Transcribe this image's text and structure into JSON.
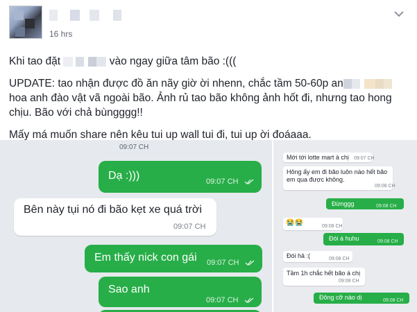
{
  "post": {
    "timestamp": "16 hrs",
    "line1_before": "Khi tao đặt",
    "line1_after": "vào ngay giữa tâm bão :(((",
    "update_text": "UPDATE: tao nhận được đồ ăn nãy giờ ời nhenn, chắc tầm 50-60p an",
    "update_rest": "hoa anh đào vật vã ngoài bão. Ảnh rủ tao bão không ảnh hốt đi, nhưng tao hong chịu. Bão với chả bùngggg!!",
    "share_text": "Mấy má muốn share nên kêu tui up wall tui đi, tui up ời đoáaaa.",
    "chevron_icon": "chevron-down-icon"
  },
  "left_chat": {
    "top_partial_time": "09:07 CH",
    "messages": [
      {
        "type": "sent",
        "text": "Dạ :)))",
        "time": "09:07 CH"
      },
      {
        "type": "received",
        "text": "Bên này tụi nó đi bão kẹt xe quá trời",
        "time": "09:07 CH"
      },
      {
        "type": "sent",
        "text": "Em thấy nick con gái",
        "time": "09:07 CH"
      },
      {
        "type": "sent",
        "text": "Sao anh",
        "time": "09:07 CH"
      }
    ]
  },
  "right_chat": {
    "messages": [
      {
        "type": "received",
        "text": "Mới tới lotte mart à chị",
        "time": "09:07 CH"
      },
      {
        "type": "received",
        "text": "Hông ấy em đi bão luôn nào hết bão em qua được không.",
        "time": "09:08 CH"
      },
      {
        "type": "sent",
        "text": "Đừnggg",
        "time": "09:08 CH"
      },
      {
        "type": "received",
        "text": "😭😭",
        "time": "09:08 CH"
      },
      {
        "type": "sent",
        "text": "Đói á huhu",
        "time": "09:08 CH"
      },
      {
        "type": "received",
        "text": "Đói hả :(",
        "time": "09:08 CH"
      },
      {
        "type": "received",
        "text": "Tầm 1h chắc hết bão á chị",
        "time": "09:08 CH"
      },
      {
        "type": "sent",
        "text": "Đông cỡ nào dị",
        "time": "09:08 CH"
      }
    ]
  },
  "colors": {
    "bubble_green": "#27ae48",
    "chat_bg": "#e6e9ed",
    "text": "#1d2129"
  }
}
